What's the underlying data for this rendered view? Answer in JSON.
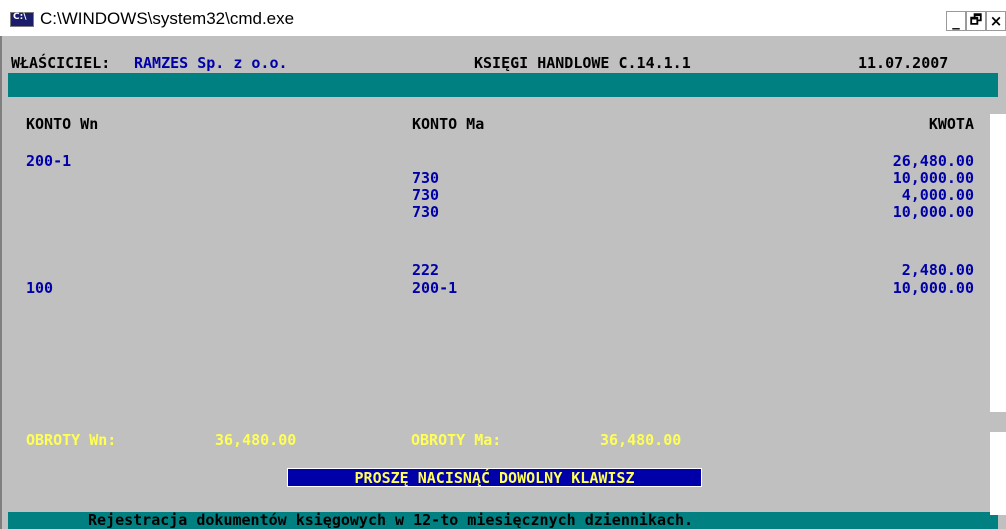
{
  "window": {
    "title": "C:\\WINDOWS\\system32\\cmd.exe",
    "icon": "cmd-icon",
    "minimize_label": "_",
    "restore_label": "🗗",
    "close_label": "×"
  },
  "header": {
    "owner_label": "WŁAŚCICIEL:",
    "owner_name": "RAMZES Sp. z o.o.",
    "app_title": "KSIĘGI HANDLOWE C.14.1.1",
    "date": "11.07.2007"
  },
  "columns": {
    "konto_wn": "KONTO Wn",
    "konto_ma": "KONTO Ma",
    "kwota": "KWOTA"
  },
  "rows": [
    {
      "wn": "200-1",
      "ma": "",
      "kwota": "26,480.00"
    },
    {
      "wn": "",
      "ma": "730",
      "kwota": "10,000.00"
    },
    {
      "wn": "",
      "ma": "730",
      "kwota": "4,000.00"
    },
    {
      "wn": "",
      "ma": "730",
      "kwota": "10,000.00"
    },
    {
      "wn": "",
      "ma": "222",
      "kwota": "2,480.00"
    },
    {
      "wn": "100",
      "ma": "200-1",
      "kwota": "10,000.00"
    }
  ],
  "totals": {
    "wn_label": "OBROTY Wn:",
    "wn_value": "36,480.00",
    "ma_label": "OBROTY Ma:",
    "ma_value": "36,480.00"
  },
  "prompt": "PROSZĘ NACISNĄĆ DOWOLNY KLAWISZ",
  "status_bar": "Rejestracja dokumentów księgowych w 12-to miesięcznych dziennikach.",
  "colors": {
    "console_bg": "#c0c0c0",
    "teal": "#008080",
    "text_blue": "#0000a8",
    "text_yellow": "#ffff55"
  }
}
